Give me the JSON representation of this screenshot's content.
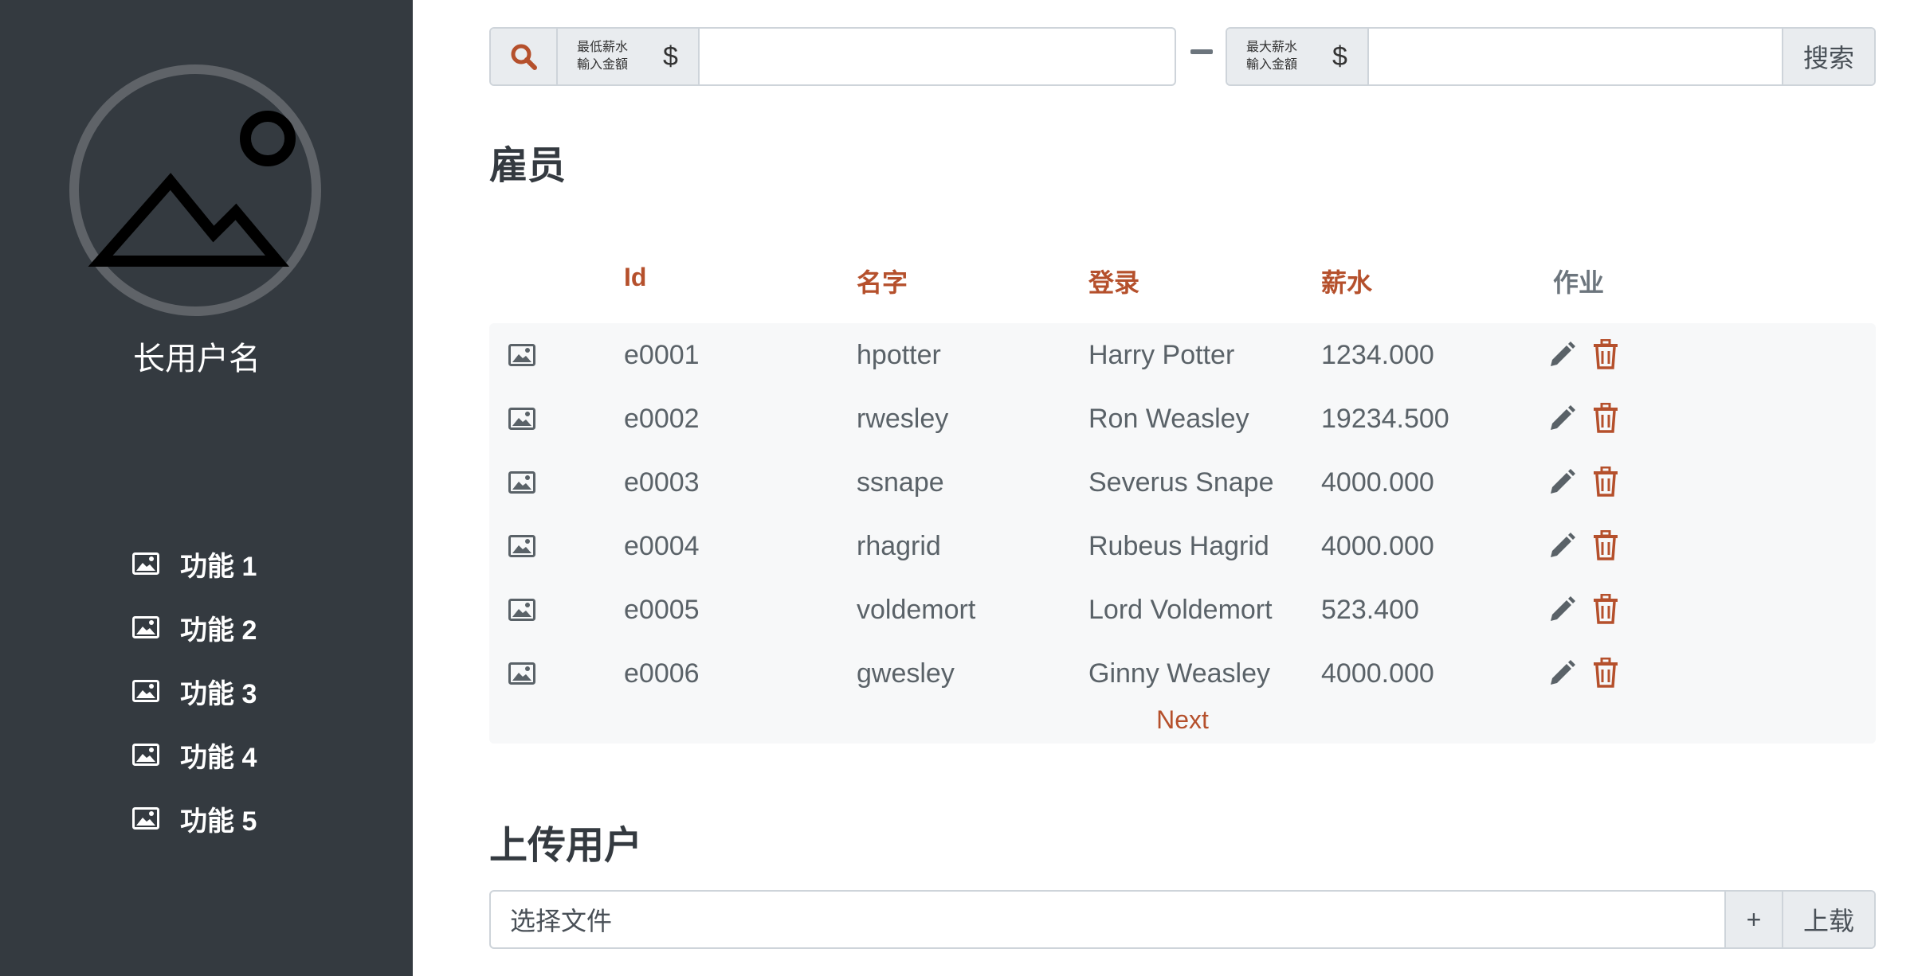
{
  "sidebar": {
    "username": "长用户名",
    "avatar_icon": "image-placeholder-icon",
    "items": [
      {
        "label": "功能 1",
        "icon": "image-icon"
      },
      {
        "label": "功能 2",
        "icon": "image-icon"
      },
      {
        "label": "功能 3",
        "icon": "image-icon"
      },
      {
        "label": "功能 4",
        "icon": "image-icon"
      },
      {
        "label": "功能 5",
        "icon": "image-icon"
      }
    ]
  },
  "search": {
    "icon": "search-icon",
    "min_label_line1": "最低薪水",
    "min_label_line2": "輸入金額",
    "max_label_line1": "最大薪水",
    "max_label_line2": "輸入金額",
    "currency": "$",
    "min_value": "",
    "max_value": "",
    "button_label": "搜索"
  },
  "employees": {
    "title": "雇员",
    "columns": [
      "Id",
      "名字",
      "登录",
      "薪水",
      "作业"
    ],
    "rows": [
      {
        "id": "e0001",
        "name": "hpotter",
        "login": "Harry Potter",
        "salary": "1234.000"
      },
      {
        "id": "e0002",
        "name": "rwesley",
        "login": "Ron Weasley",
        "salary": "19234.500"
      },
      {
        "id": "e0003",
        "name": "ssnape",
        "login": "Severus Snape",
        "salary": "4000.000"
      },
      {
        "id": "e0004",
        "name": "rhagrid",
        "login": "Rubeus Hagrid",
        "salary": "4000.000"
      },
      {
        "id": "e0005",
        "name": "voldemort",
        "login": "Lord Voldemort",
        "salary": "523.400"
      },
      {
        "id": "e0006",
        "name": "gwesley",
        "login": "Ginny Weasley",
        "salary": "4000.000"
      }
    ],
    "row_icons": [
      "image-icon",
      "pencil-icon",
      "trash-icon"
    ],
    "next_label": "Next"
  },
  "upload": {
    "title": "上传用户",
    "file_placeholder": "选择文件",
    "plus_label": "+",
    "button_label": "上载"
  },
  "colors": {
    "sidebar_bg": "#343a40",
    "accent": "#b5502c",
    "muted": "#6c757d",
    "table_bg": "#f7f8f9"
  }
}
